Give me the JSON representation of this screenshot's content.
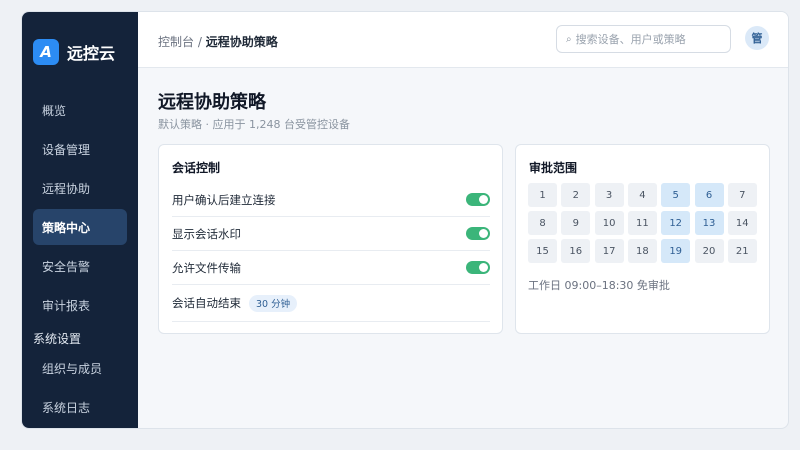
{
  "brand": {
    "logo_letter": "A",
    "name": "远控云"
  },
  "sidebar": {
    "items": [
      {
        "label": "概览",
        "active": false
      },
      {
        "label": "设备管理",
        "active": false
      },
      {
        "label": "远程协助",
        "active": false
      },
      {
        "label": "策略中心",
        "active": true
      },
      {
        "label": "安全告警",
        "active": false
      },
      {
        "label": "审计报表",
        "active": false
      }
    ],
    "group_label": "系统设置",
    "group_items": [
      {
        "label": "组织与成员"
      },
      {
        "label": "系统日志"
      }
    ]
  },
  "header": {
    "breadcrumb_root": "控制台",
    "breadcrumb_sep": "/",
    "breadcrumb_current": "远程协助策略",
    "search_placeholder": "搜索设备、用户或策略",
    "search_icon": "search-icon",
    "avatar_text": "管"
  },
  "main": {
    "title": "远程协助策略",
    "subtitle": "默认策略 · 应用于 1,248 台受管控设备"
  },
  "session_card": {
    "title": "会话控制",
    "rows": [
      {
        "label": "用户确认后建立连接",
        "toggle": true
      },
      {
        "label": "显示会话水印",
        "toggle": true
      },
      {
        "label": "允许文件传输",
        "toggle": true
      }
    ],
    "auto_end_label": "会话自动结束",
    "auto_end_value": "30 分钟"
  },
  "approval_card": {
    "title": "审批范围",
    "days": [
      "1",
      "2",
      "3",
      "4",
      "5",
      "6",
      "7",
      "8",
      "9",
      "10",
      "11",
      "12",
      "13",
      "14",
      "15",
      "16",
      "17",
      "18",
      "19",
      "20",
      "21"
    ],
    "selected": [
      "5",
      "6",
      "12",
      "13",
      "19"
    ],
    "note": "工作日 09:00–18:30 免审批"
  },
  "colors": {
    "sidebar_bg": "#14233a",
    "accent": "#2c8cf4",
    "toggle_on": "#3bb57a",
    "selected_cell": "#d5e8f9"
  }
}
